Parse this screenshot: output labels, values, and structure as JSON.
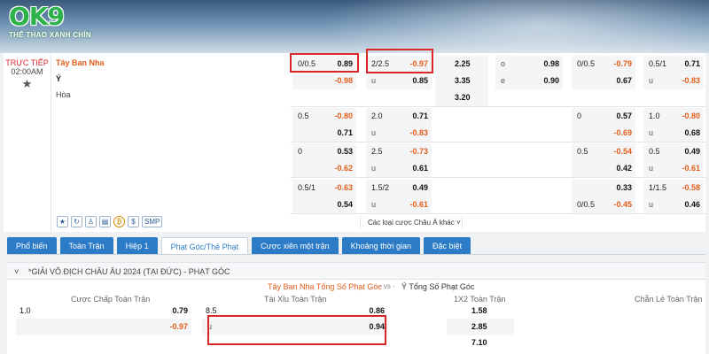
{
  "brand": {
    "logo": "OK9",
    "tagline": "THỂ THAO XANH CHÍN"
  },
  "match": {
    "status": "TRỰC TIẾP",
    "time": "02:00AM",
    "home": "Tây Ban Nha",
    "away": "Ý",
    "draw": "Hòa"
  },
  "odds": {
    "hdp": [
      {
        "line": "0/0.5",
        "home": "0.89",
        "away": "-0.98"
      },
      {
        "line": "0.5",
        "home": "-0.80",
        "away": "0.71"
      },
      {
        "line": "0",
        "home": "0.53",
        "away": "-0.62"
      },
      {
        "line": "0.5/1",
        "home": "-0.63",
        "away": "0.54"
      }
    ],
    "ou": [
      {
        "line": "2/2.5",
        "over": "-0.97",
        "under_label": "u",
        "under": "0.85"
      },
      {
        "line": "2.0",
        "over": "0.71",
        "under_label": "u",
        "under": "-0.83"
      },
      {
        "line": "2.5",
        "over": "-0.73",
        "under_label": "u",
        "under": "0.61"
      },
      {
        "line": "1.5/2",
        "over": "0.49",
        "under_label": "u",
        "under": "-0.61"
      }
    ],
    "x12": [
      "2.25",
      "3.35",
      "3.20"
    ],
    "oe": [
      {
        "label": "o",
        "value": "0.98"
      },
      {
        "label": "e",
        "value": "0.90"
      }
    ],
    "h1_hdp": [
      {
        "line": "0/0.5",
        "home": "-0.79",
        "away": "0.67"
      },
      {
        "line": "0",
        "home": "0.57",
        "away": "-0.69"
      },
      {
        "line": "0.5",
        "home": "-0.54",
        "away": "0.42"
      },
      {
        "line": "",
        "home": "0.33",
        "line2": "0/0.5",
        "away": "-0.45"
      }
    ],
    "h1_ou": [
      {
        "line": "0.5/1",
        "over": "0.71",
        "under_label": "u",
        "under": "-0.83"
      },
      {
        "line": "1.0",
        "over": "-0.80",
        "under_label": "u",
        "under": "0.68"
      },
      {
        "line": "0.5",
        "over": "0.49",
        "under_label": "u",
        "under": "-0.61"
      },
      {
        "line": "1/1.5",
        "over": "-0.58",
        "under_label": "u",
        "under": "0.46"
      }
    ]
  },
  "icons": [
    "star-icon",
    "refresh-icon",
    "shirt-icon",
    "table-icon",
    "bet-icon",
    "dollar-icon"
  ],
  "smp": "SMP",
  "more_label": "Các loại cược Châu Á khác",
  "tabs": [
    "Phổ biến",
    "Toàn Trận",
    "Hiệp 1",
    "Phạt Góc/Thẻ Phạt",
    "Cược xiên một trận",
    "Khoảng thời gian",
    "Đặc biệt"
  ],
  "active_tab": 3,
  "corner": {
    "title": "*GIẢI VÔ ĐỊCH CHÂU ÂU 2024 (TẠI ĐỨC) - PHẠT GÓC",
    "home_label": "Tây Ban Nha Tổng Số Phạt Góc",
    "vs": "- vs -",
    "away_label": "Ý Tổng Số Phạt Góc",
    "col_headers": [
      "Cược Chấp Toàn Trận",
      "Tài Xỉu Toàn Trận",
      "1X2 Toàn Trận",
      "Chẵn Lẻ Toàn Trận"
    ],
    "hdp": {
      "line": "1.0",
      "home": "0.79",
      "away": "-0.97"
    },
    "ou": {
      "line": "8.5",
      "over": "0.86",
      "under_label": "u",
      "under": "0.94"
    },
    "x12": [
      "1.58",
      "2.85",
      "7.10"
    ]
  },
  "colors": {
    "accent": "#2c7bc7",
    "negative": "#e35d1a",
    "live": "#d9262a",
    "highlight_box": "#d9262a"
  }
}
